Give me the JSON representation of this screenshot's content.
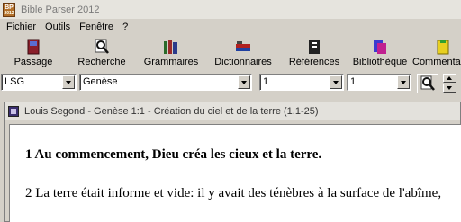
{
  "window": {
    "title": "Bible Parser 2012",
    "icon": "bp-app-icon"
  },
  "menu": [
    "Fichier",
    "Outils",
    "Fenêtre",
    "?"
  ],
  "toolbar": [
    {
      "label": "Passage",
      "icon": "book-icon"
    },
    {
      "label": "Recherche",
      "icon": "magnifier-icon"
    },
    {
      "label": "Grammaires",
      "icon": "grammar-icon"
    },
    {
      "label": "Dictionnaires",
      "icon": "dictionary-icon"
    },
    {
      "label": "Références",
      "icon": "references-icon"
    },
    {
      "label": "Bibliothèque",
      "icon": "library-icon"
    },
    {
      "label": "Commentaire",
      "icon": "commentary-icon"
    }
  ],
  "selectors": {
    "version": "LSG",
    "book": "Genèse",
    "chapter": "1",
    "verse": "1"
  },
  "passage_window": {
    "title": "Louis Segond - Genèse 1:1 - Création du ciel et de la terre (1.1-25)",
    "verses": [
      "1 Au commencement, Dieu créa les cieux et la terre.",
      "2 La terre était informe et vide: il y avait des ténèbres à la surface de l'abîme,"
    ]
  }
}
